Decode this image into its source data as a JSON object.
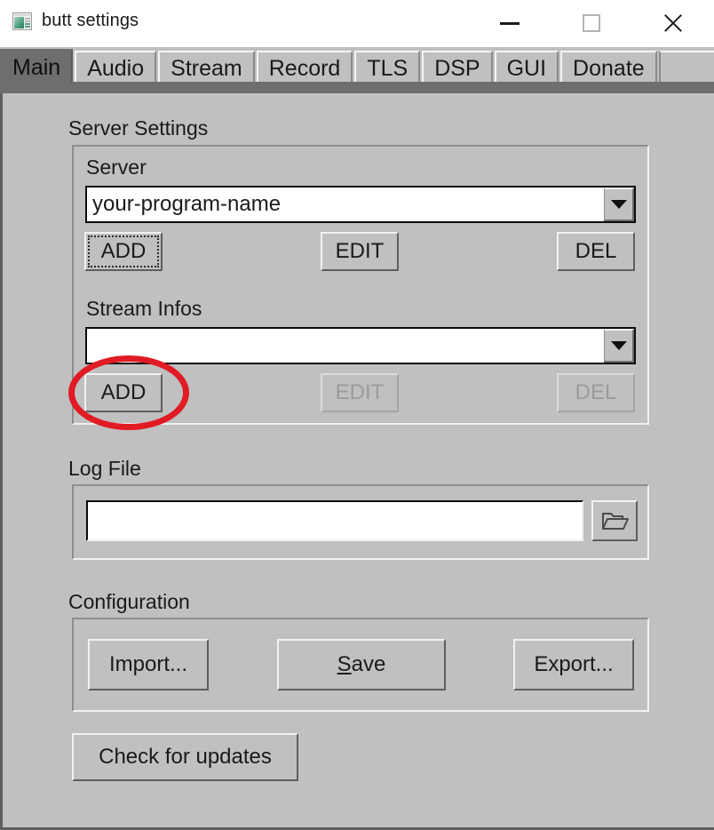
{
  "window": {
    "title": "butt settings",
    "icon": "app-window-icon",
    "controls": {
      "minimize": "minimize-icon",
      "maximize": "maximize-icon",
      "close": "close-icon"
    }
  },
  "tabs": [
    {
      "label": "Main",
      "selected": true
    },
    {
      "label": "Audio",
      "selected": false
    },
    {
      "label": "Stream",
      "selected": false
    },
    {
      "label": "Record",
      "selected": false
    },
    {
      "label": "TLS",
      "selected": false
    },
    {
      "label": "DSP",
      "selected": false
    },
    {
      "label": "GUI",
      "selected": false
    },
    {
      "label": "Donate",
      "selected": false
    }
  ],
  "server_settings": {
    "group_label": "Server Settings",
    "server": {
      "label": "Server",
      "value": "your-program-name",
      "arrow": "chevron-down-icon",
      "buttons": {
        "add": "ADD",
        "edit": "EDIT",
        "del": "DEL"
      }
    },
    "stream_infos": {
      "label": "Stream Infos",
      "value": "",
      "arrow": "chevron-down-icon",
      "buttons": {
        "add": "ADD",
        "edit": "EDIT",
        "del": "DEL"
      }
    }
  },
  "log_file": {
    "group_label": "Log File",
    "value": "",
    "placeholder": "",
    "browse_icon": "folder-open-icon"
  },
  "configuration": {
    "group_label": "Configuration",
    "import_label": "Import...",
    "save_label_prefix": "",
    "save_mnemonic": "S",
    "save_label_suffix": "ave",
    "export_label": "Export..."
  },
  "check_for_updates_label": "Check for updates",
  "annotation": {
    "shape": "ellipse",
    "color": "#e01b24",
    "target": "stream-infos-add-button"
  }
}
